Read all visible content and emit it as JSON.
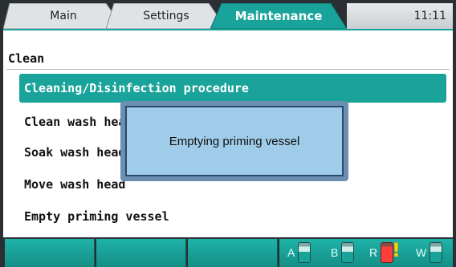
{
  "tabs": {
    "main": "Main",
    "settings": "Settings",
    "maintenance": "Maintenance",
    "active": "Maintenance"
  },
  "clock": "11:11",
  "panel": {
    "title": "Clean",
    "items": [
      {
        "label": "Cleaning/Disinfection procedure",
        "selected": true
      },
      {
        "label": "Clean wash head",
        "selected": false
      },
      {
        "label": "Soak wash head",
        "selected": false
      },
      {
        "label": "Move wash head",
        "selected": false
      },
      {
        "label": "Empty priming vessel",
        "selected": false
      }
    ]
  },
  "dialog": {
    "message": "Emptying priming vessel"
  },
  "status": {
    "containers": [
      {
        "letter": "A",
        "icon": "bottle-icon",
        "state": "ok"
      },
      {
        "letter": "B",
        "icon": "bottle-icon",
        "state": "ok"
      },
      {
        "letter": "R",
        "icon": "bottle-icon",
        "state": "warning"
      },
      {
        "letter": "W",
        "icon": "bottle-icon",
        "state": "ok"
      }
    ]
  },
  "colors": {
    "accent": "#1aa39a",
    "dialog_fill": "#9fcce8",
    "warning": "#ffd200",
    "alert": "#ff3d3d"
  }
}
